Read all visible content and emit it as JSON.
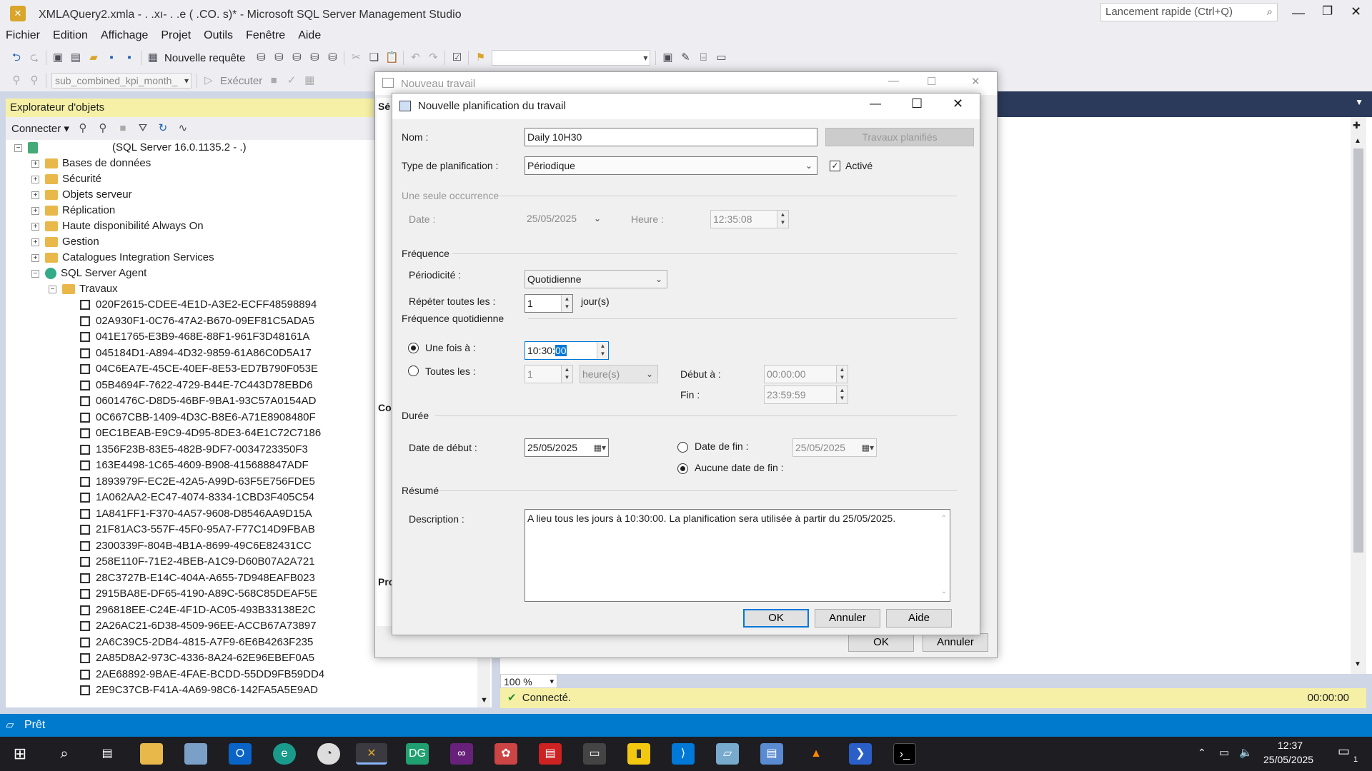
{
  "app": {
    "title": "XMLAQuery2.xmla - .          .xı-          .          .e (       .CO.          s)* - Microsoft SQL Server Management Studio",
    "quick_launch_placeholder": "Lancement rapide (Ctrl+Q)"
  },
  "menu": [
    "Fichier",
    "Edition",
    "Affichage",
    "Projet",
    "Outils",
    "Fenêtre",
    "Aide"
  ],
  "toolbar": {
    "new_query": "Nouvelle requête",
    "database_combo": "sub_combined_kpi_month_",
    "execute": "Exécuter"
  },
  "object_explorer": {
    "title": "Explorateur d'objets",
    "connect": "Connecter",
    "server": "(SQL Server 16.0.1135.2 -           .)",
    "nodes": [
      "Bases de données",
      "Sécurité",
      "Objets serveur",
      "Réplication",
      "Haute disponibilité Always On",
      "Gestion",
      "Catalogues Integration Services"
    ],
    "agent": "SQL Server Agent",
    "jobs_folder": "Travaux",
    "jobs": [
      "020F2615-CDEE-4E1D-A3E2-ECFF48598894",
      "02A930F1-0C76-47A2-B670-09EF81C5ADA5",
      "041E1765-E3B9-468E-88F1-961F3D48161A",
      "045184D1-A894-4D32-9859-61A86C0D5A17",
      "04C6EA7E-45CE-40EF-8E53-ED7B790F053E",
      "05B4694F-7622-4729-B44E-7C443D78EBD6",
      "0601476C-D8D5-46BF-9BA1-93C57A0154AD",
      "0C667CBB-1409-4D3C-B8E6-A71E8908480F",
      "0EC1BEAB-E9C9-4D95-8DE3-64E1C72C7186",
      "1356F23B-83E5-482B-9DF7-0034723350F3",
      "163E4498-1C65-4609-B908-415688847ADF",
      "1893979F-EC2E-42A5-A99D-63F5E756FDE5",
      "1A062AA2-EC47-4074-8334-1CBD3F405C54",
      "1A841FF1-F370-4A57-9608-D8546AA9D15A",
      "21F81AC3-557F-45F0-95A7-F77C14D9FBAB",
      "2300339F-804B-4B1A-8699-49C6E82431CC",
      "258E110F-71E2-4BEB-A1C9-D60B07A2A721",
      "28C3727B-E14C-404A-A655-7D948EAFB023",
      "2915BA8E-DF65-4190-A89C-568C85DEAF5E",
      "296818EE-C24E-4F1D-AC05-493B33138E2C",
      "2A26AC21-6D38-4509-96EE-ACCB67A73897",
      "2A6C39C5-2DB4-4815-A7F9-6E6B4263F235",
      "2A85D8A2-973C-4336-8A24-62E96EBEF0A5",
      "2AE68892-9BAE-4FAE-BCDD-55DD9FB59DD4",
      "2E9C37CB-F41A-4A69-98C6-142FA5A5E9AD"
    ]
  },
  "editor": {
    "zoom": "100 %",
    "status": "Connecté.",
    "elapsed": "00:00:00"
  },
  "parent_dialog": {
    "title": "Nouveau travail",
    "ok": "OK",
    "cancel": "Annuler",
    "side_labels": [
      "Sé",
      "Co",
      "Pro"
    ]
  },
  "dialog": {
    "title": "Nouvelle planification du travail",
    "name_label": "Nom :",
    "name_value": "Daily 10H30",
    "jobs_button": "Travaux planifiés",
    "schedule_type_label": "Type de planification :",
    "schedule_type_value": "Périodique",
    "enabled_label": "Activé",
    "one_time_group": "Une seule occurrence",
    "date_label": "Date :",
    "date_value": "25/05/2025",
    "time_label": "Heure :",
    "time_value": "12:35:08",
    "frequency_group": "Fréquence",
    "occurs_label": "Périodicité :",
    "occurs_value": "Quotidienne",
    "recurs_label": "Répéter toutes les :",
    "recurs_value": "1",
    "recurs_unit": "jour(s)",
    "daily_group": "Fréquence quotidienne",
    "once_label": "Une fois à :",
    "once_value_prefix": "10:30:",
    "once_value_selected": "00",
    "every_label": "Toutes les :",
    "every_value": "1",
    "every_unit": "heure(s)",
    "start_at_label": "Début à :",
    "start_at_value": "00:00:00",
    "end_at_label": "Fin :",
    "end_at_value": "23:59:59",
    "duration_group": "Durée",
    "start_date_label": "Date de début :",
    "start_date_value": "25/05/2025",
    "end_date_label": "Date de fin :",
    "end_date_value": "25/05/2025",
    "no_end_label": "Aucune date de fin :",
    "summary_group": "Résumé",
    "description_label": "Description :",
    "description_value": "A lieu tous les jours à 10:30:00. La planification sera utilisée à partir du 25/05/2025.",
    "ok": "OK",
    "cancel": "Annuler",
    "help": "Aide"
  },
  "status": "Prêt",
  "clock": {
    "time": "12:37",
    "date": "25/05/2025"
  },
  "notifications": "1"
}
